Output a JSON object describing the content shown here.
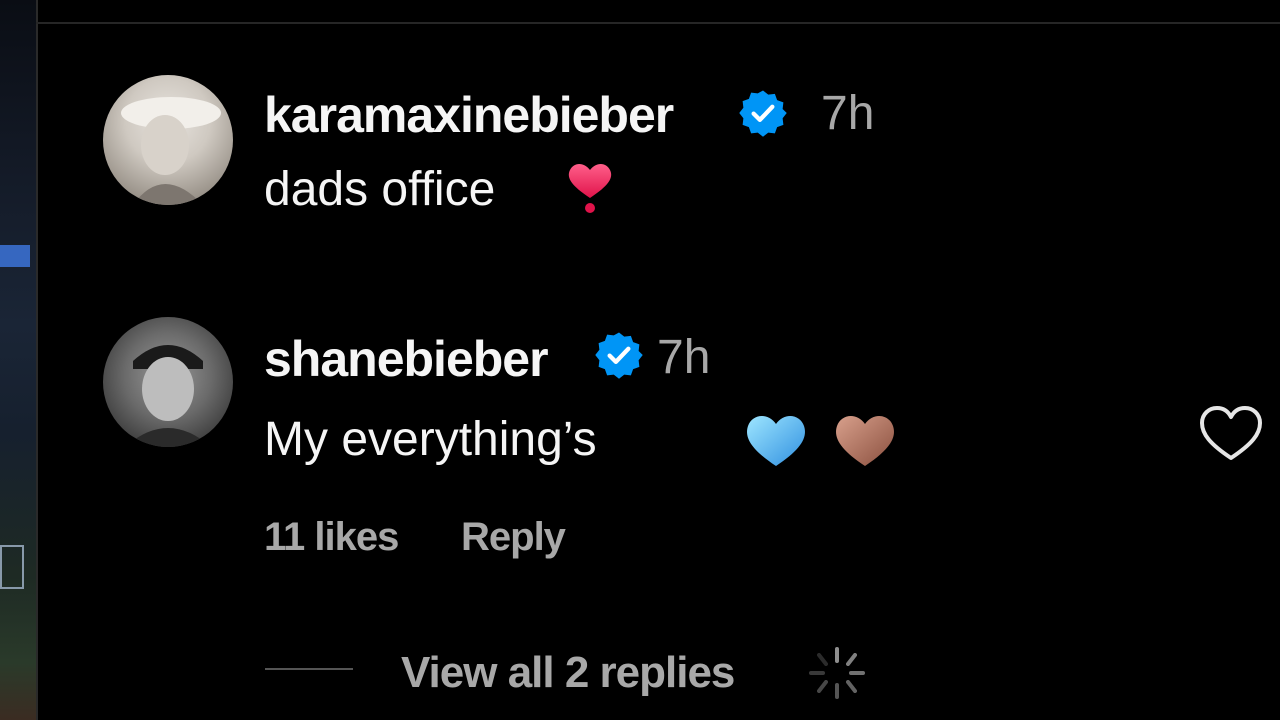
{
  "comments": [
    {
      "username": "karamaxinebieber",
      "time": "7h",
      "text": "dads office",
      "emoji_icon": "pink-heart-exclamation-icon"
    },
    {
      "username": "shanebieber",
      "time": "7h",
      "text": "My everything’s",
      "emoji_icons": [
        "light-blue-heart-icon",
        "brown-heart-icon"
      ],
      "likes": "11 likes",
      "reply_label": "Reply",
      "view_replies": "View all 2 replies"
    }
  ],
  "colors": {
    "background": "#000000",
    "verified": "#0095f6",
    "muted_text": "#a8a8a8"
  }
}
